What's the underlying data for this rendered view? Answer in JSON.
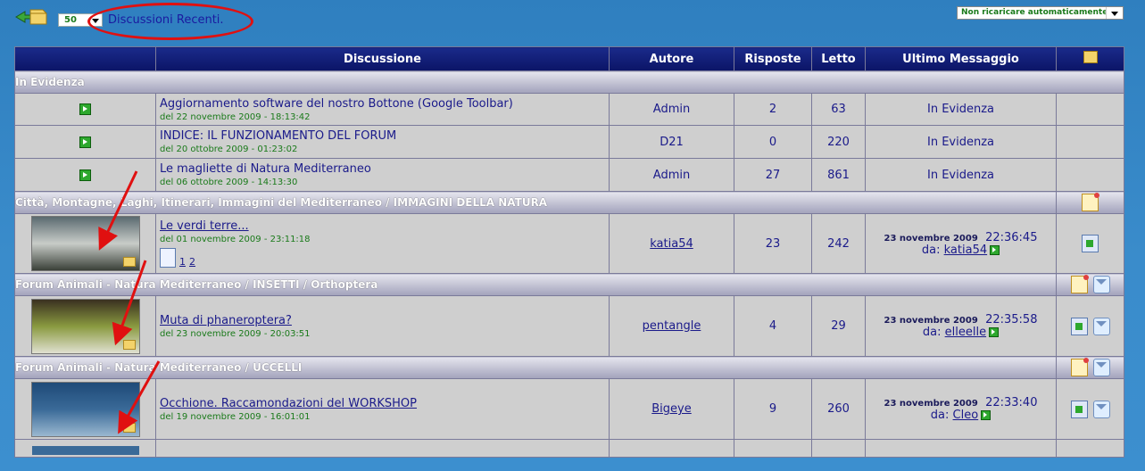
{
  "top": {
    "page_size": "50",
    "recent_link": "Discussioni Recenti.",
    "reload_option": "Non ricaricare automaticamente"
  },
  "table": {
    "headers": [
      "Discussione",
      "Autore",
      "Risposte",
      "Letto",
      "Ultimo Messaggio"
    ],
    "sticky_category": "In Evidenza",
    "sticky": [
      {
        "title": "Aggiornamento software del nostro Bottone (Google Toolbar)",
        "date": "del 22 novembre 2009 - 18:13:42",
        "author": "Admin",
        "replies": "2",
        "views": "63",
        "last": "In Evidenza"
      },
      {
        "title": "INDICE: IL FUNZIONAMENTO DEL FORUM",
        "date": "del 20 ottobre 2009 - 01:23:02",
        "author": "D21",
        "replies": "0",
        "views": "220",
        "last": "In Evidenza"
      },
      {
        "title": "Le magliette di Natura Mediterraneo",
        "date": "del 06 ottobre 2009 - 14:13:30",
        "author": "Admin",
        "replies": "27",
        "views": "861",
        "last": "In Evidenza"
      }
    ],
    "groups": [
      {
        "category": "Città, Montagne, Laghi, Itinerari, Immagini del Mediterraneo / IMMAGINI DELLA NATURA",
        "title": "Le verdi terre...",
        "date": "del 01 novembre 2009 - 23:11:18",
        "pages": [
          "1",
          "2"
        ],
        "author": "katia54",
        "replies": "23",
        "views": "242",
        "last_date": "23 novembre 2009",
        "last_time": "22:36:45",
        "last_prefix": "da:",
        "last_user": "katia54",
        "thumb_colors": [
          "#5a6a70",
          "#c8ccc8",
          "#3a4038"
        ]
      },
      {
        "category": "Forum Animali - Natura Mediterraneo / INSETTI / Orthoptera",
        "title": "Muta di phaneroptera?",
        "date": "del 23 novembre 2009 - 20:03:51",
        "author": "pentangle",
        "replies": "4",
        "views": "29",
        "last_date": "23 novembre 2009",
        "last_time": "22:35:58",
        "last_prefix": "da:",
        "last_user": "elleelle",
        "thumb_colors": [
          "#3a3020",
          "#8a9a40",
          "#e0e0d0"
        ]
      },
      {
        "category": "Forum Animali - Natura Mediterraneo / UCCELLI",
        "title": "Occhione. Raccamondazioni del WORKSHOP",
        "date": "del 19 novembre 2009 - 16:01:01",
        "author": "Bigeye",
        "replies": "9",
        "views": "260",
        "last_date": "23 novembre 2009",
        "last_time": "22:33:40",
        "last_prefix": "da:",
        "last_user": "Cleo",
        "thumb_colors": [
          "#1e4a78",
          "#3a6a98",
          "#9ab8d0"
        ]
      }
    ]
  }
}
